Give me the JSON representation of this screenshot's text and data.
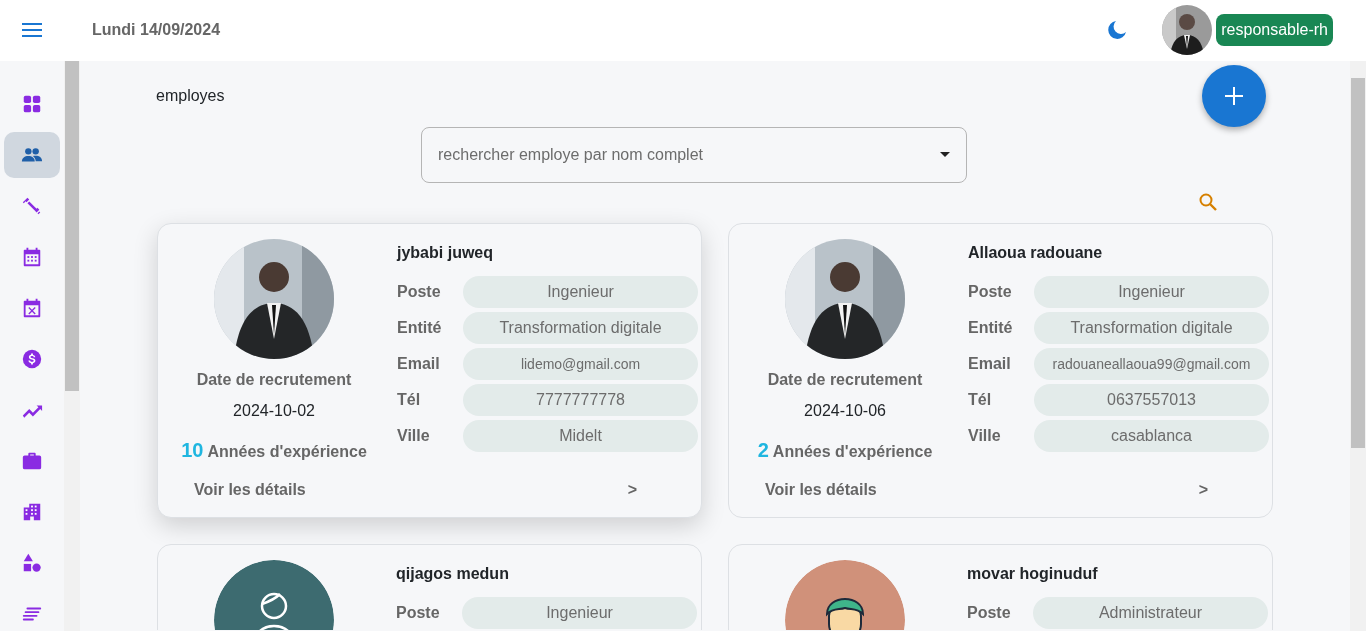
{
  "header": {
    "date": "Lundi 14/09/2024",
    "role_badge": "responsable-rh"
  },
  "sidebar": {
    "items": [
      {
        "selected": false
      },
      {
        "selected": true
      },
      {
        "selected": false
      },
      {
        "selected": false
      },
      {
        "selected": false
      },
      {
        "selected": false
      },
      {
        "selected": false
      },
      {
        "selected": false
      },
      {
        "selected": false
      },
      {
        "selected": false
      },
      {
        "selected": false
      }
    ]
  },
  "page": {
    "title": "employes",
    "search": {
      "placeholder": "rechercher employe par nom complet"
    }
  },
  "employees": [
    {
      "name": "jybabi juweq",
      "highlighted": true,
      "hire_label": "Date de recrutement",
      "hire_date": "2024-10-02",
      "experience_years": "10",
      "experience_label": "Années d'expérience",
      "details_link": "Voir les détails",
      "details_arrow": ">",
      "fields": [
        {
          "label": "Poste",
          "value": "Ingenieur"
        },
        {
          "label": "Entité",
          "value": "Transformation digitale"
        },
        {
          "label": "Email",
          "value": "lidemo@gmail.com",
          "kind": "small"
        },
        {
          "label": "Tél",
          "value": "7777777778"
        },
        {
          "label": "Ville",
          "value": "Midelt"
        }
      ]
    },
    {
      "name": "Allaoua radouane",
      "highlighted": false,
      "hire_label": "Date de recrutement",
      "hire_date": "2024-10-06",
      "experience_years": "2",
      "experience_label": "Années d'expérience",
      "details_link": "Voir les détails",
      "details_arrow": ">",
      "fields": [
        {
          "label": "Poste",
          "value": "Ingenieur"
        },
        {
          "label": "Entité",
          "value": "Transformation digitale"
        },
        {
          "label": "Email",
          "value": "radouaneallaoua99@gmail.com",
          "kind": "small"
        },
        {
          "label": "Tél",
          "value": "0637557013"
        },
        {
          "label": "Ville",
          "value": "casablanca"
        }
      ]
    },
    {
      "name": "qijagos medun",
      "highlighted": false,
      "avatar": {
        "kind": "outline-person",
        "color": "#3d6b70"
      },
      "fields": [
        {
          "label": "Poste",
          "value": "Ingenieur"
        }
      ]
    },
    {
      "name": "movar hoginuduf",
      "highlighted": false,
      "avatar": {
        "kind": "cartoon-head",
        "color": "#d0917a"
      },
      "fields": [
        {
          "label": "Poste",
          "value": "Administrateur"
        }
      ]
    }
  ]
}
